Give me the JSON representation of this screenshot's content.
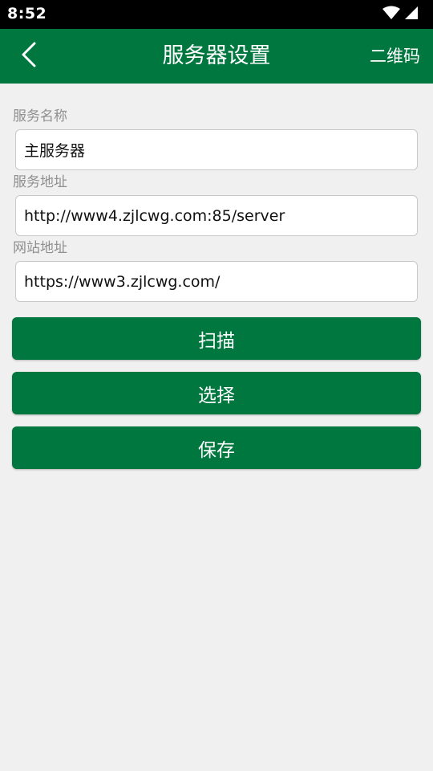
{
  "status_bar": {
    "time": "8:52",
    "icons": [
      "wifi-icon",
      "cellular-signal-icon"
    ]
  },
  "app_bar": {
    "title": "服务器设置",
    "back_icon": "chevron-left-icon",
    "qr_label": "二维码",
    "background": "#017740"
  },
  "form": {
    "service_name": {
      "label": "服务名称",
      "value": "主服务器"
    },
    "service_address": {
      "label": "服务地址",
      "value": "http://www4.zjlcwg.com:85/server"
    },
    "website_address": {
      "label": "网站地址",
      "value": "https://www3.zjlcwg.com/"
    }
  },
  "buttons": {
    "scan": "扫描",
    "select": "选择",
    "save": "保存"
  },
  "colors": {
    "accent": "#017740",
    "background": "#f0f0f0",
    "label": "#8f8f8f"
  }
}
